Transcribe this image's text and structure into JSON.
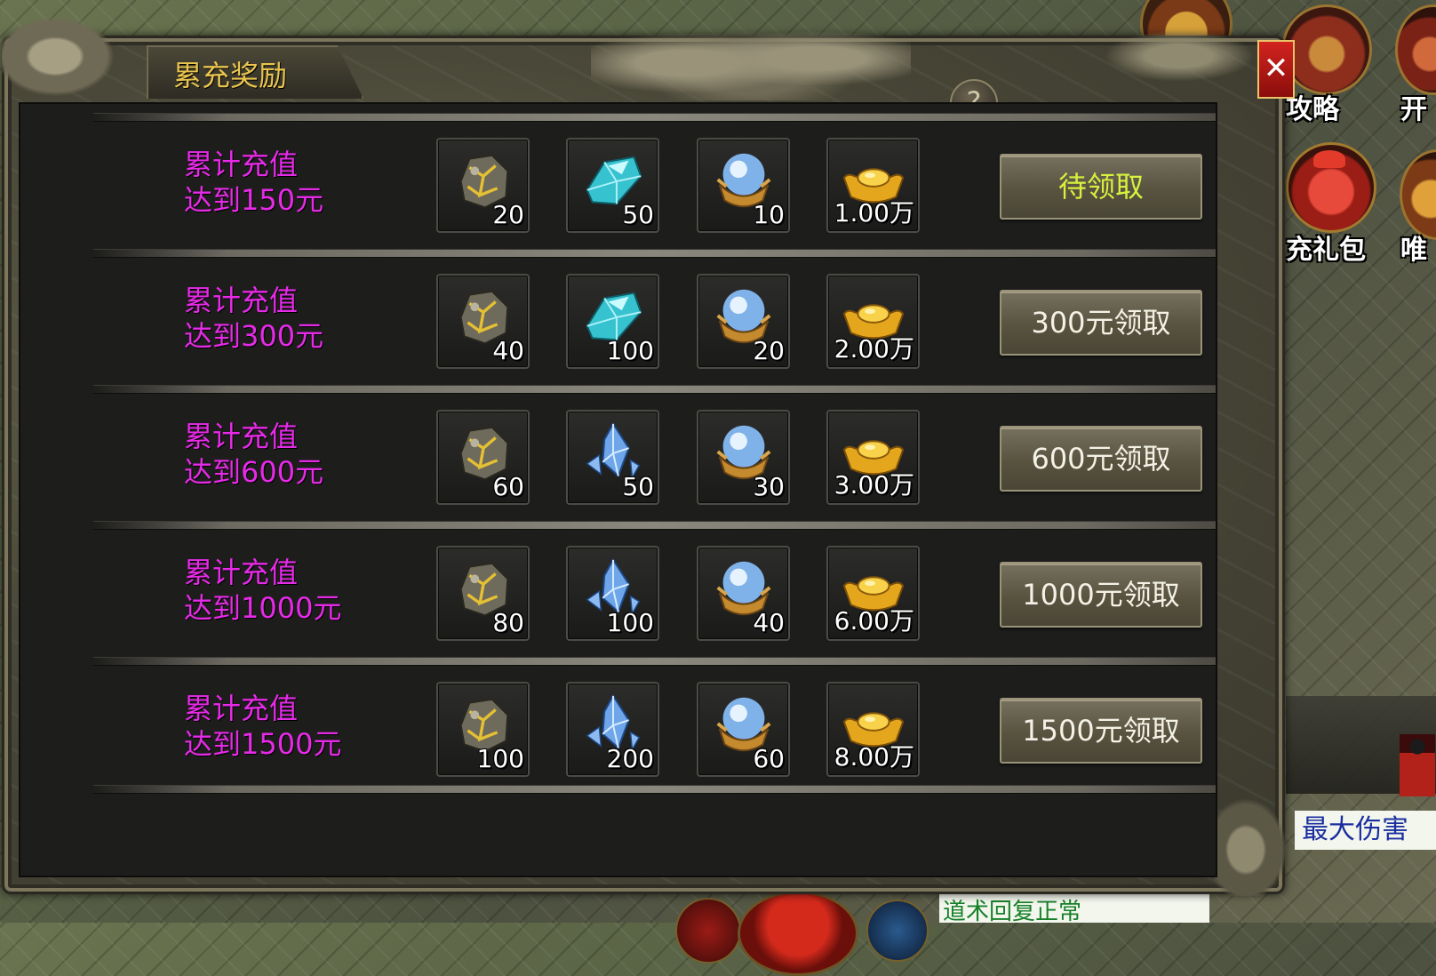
{
  "dialog": {
    "title": "累充奖励",
    "help_label": "?",
    "close_label": "✕",
    "rows": [
      {
        "label_line1": "累计充值",
        "label_line2": "达到150元",
        "items": [
          {
            "icon": "gold-vein-ore-icon",
            "count": "20"
          },
          {
            "icon": "cyan-gem-icon",
            "count": "50"
          },
          {
            "icon": "blue-orb-icon",
            "count": "10"
          },
          {
            "icon": "gold-ingot-icon",
            "count": "1.00万"
          }
        ],
        "button": "待领取",
        "button_state": "pending"
      },
      {
        "label_line1": "累计充值",
        "label_line2": "达到300元",
        "items": [
          {
            "icon": "gold-vein-ore-icon",
            "count": "40"
          },
          {
            "icon": "cyan-gem-icon",
            "count": "100"
          },
          {
            "icon": "blue-orb-icon",
            "count": "20"
          },
          {
            "icon": "gold-ingot-icon",
            "count": "2.00万"
          }
        ],
        "button": "300元领取",
        "button_state": "locked"
      },
      {
        "label_line1": "累计充值",
        "label_line2": "达到600元",
        "items": [
          {
            "icon": "gold-vein-ore-icon",
            "count": "60"
          },
          {
            "icon": "blue-crystal-icon",
            "count": "50"
          },
          {
            "icon": "blue-orb-icon",
            "count": "30"
          },
          {
            "icon": "gold-ingot-icon",
            "count": "3.00万"
          }
        ],
        "button": "600元领取",
        "button_state": "locked"
      },
      {
        "label_line1": "累计充值",
        "label_line2": "达到1000元",
        "items": [
          {
            "icon": "gold-vein-ore-icon",
            "count": "80"
          },
          {
            "icon": "blue-crystal-icon",
            "count": "100"
          },
          {
            "icon": "blue-orb-icon",
            "count": "40"
          },
          {
            "icon": "gold-ingot-icon",
            "count": "6.00万"
          }
        ],
        "button": "1000元领取",
        "button_state": "locked"
      },
      {
        "label_line1": "累计充值",
        "label_line2": "达到1500元",
        "items": [
          {
            "icon": "gold-vein-ore-icon",
            "count": "100"
          },
          {
            "icon": "blue-crystal-icon",
            "count": "200"
          },
          {
            "icon": "blue-orb-icon",
            "count": "60"
          },
          {
            "icon": "gold-ingot-icon",
            "count": "8.00万"
          }
        ],
        "button": "1500元领取",
        "button_state": "locked"
      }
    ]
  },
  "hud": {
    "strategy_label": "攻略",
    "open_label": "开",
    "recharge_pack_label": "充礼包",
    "only_label": "唯",
    "chat_damage": "最大伤害",
    "chat_bottom": "道术回复正常"
  },
  "colors": {
    "requirement_text": "#e62ae8",
    "pending_button_text": "#d6f13e",
    "title_text": "#e9c54e",
    "close_button": "#d3231f"
  }
}
